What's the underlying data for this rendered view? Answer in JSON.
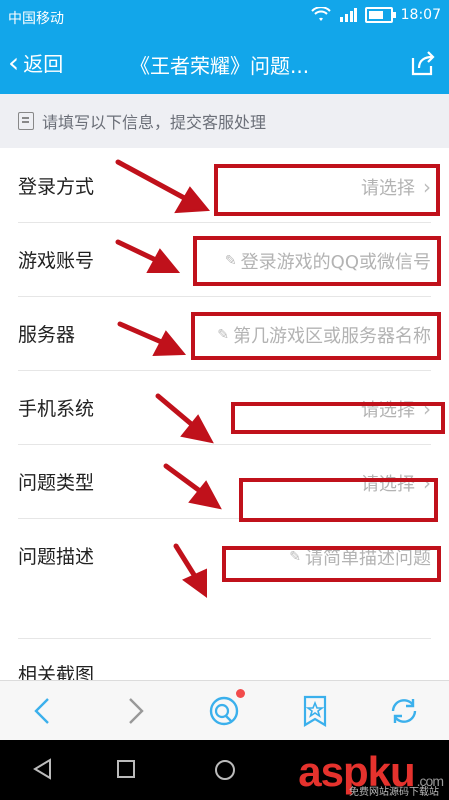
{
  "status_bar": {
    "carrier": "中国移动",
    "time": "18:07"
  },
  "nav": {
    "back_label": "返回",
    "title": "《王者荣耀》问题..."
  },
  "notice": "请填写以下信息，提交客服处理",
  "form": {
    "rows": [
      {
        "label": "登录方式",
        "value": "请选择"
      },
      {
        "label": "游戏账号",
        "value": "登录游戏的QQ或微信号"
      },
      {
        "label": "服务器",
        "value": "第几游戏区或服务器名称"
      },
      {
        "label": "手机系统",
        "value": "请选择"
      },
      {
        "label": "问题类型",
        "value": "请选择"
      },
      {
        "label": "问题描述",
        "value": "请简单描述问题"
      }
    ],
    "screenshot_label": "相关截图"
  },
  "watermark": {
    "brand": "aspku",
    "domain": ".com",
    "sub": "免费网站源码下载站"
  },
  "colors": {
    "accent": "#12a6ea",
    "annotation_red": "#c0111b"
  }
}
